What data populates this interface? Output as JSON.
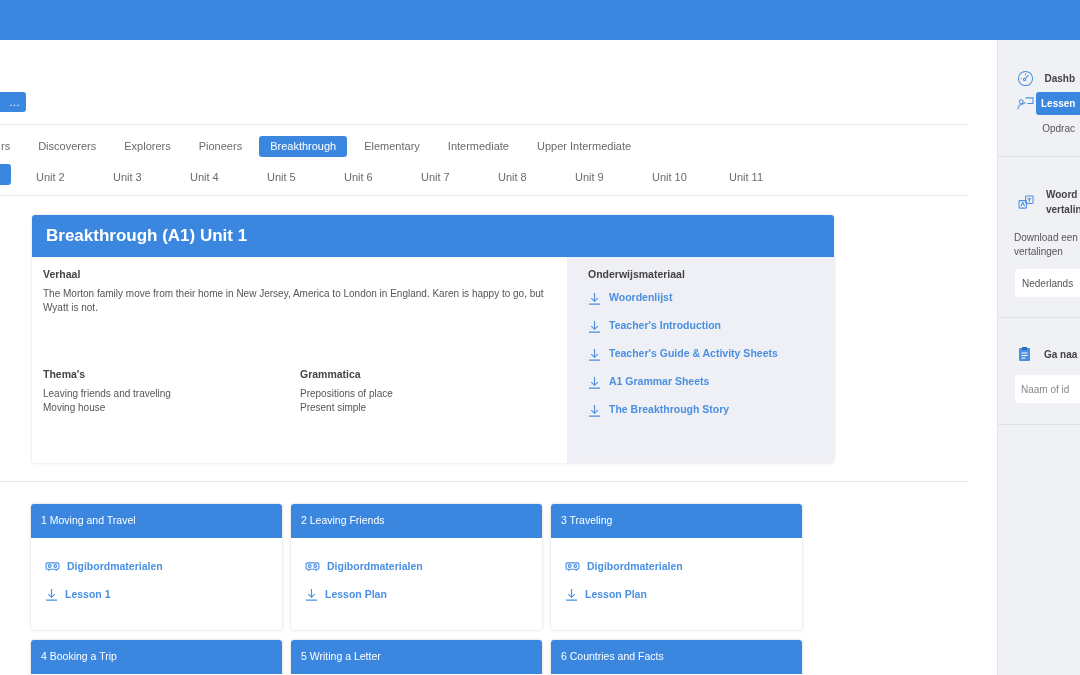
{
  "top_button": {
    "label": "…"
  },
  "levels": [
    {
      "label": "rs",
      "selected": false
    },
    {
      "label": "Discoverers",
      "selected": false
    },
    {
      "label": "Explorers",
      "selected": false
    },
    {
      "label": "Pioneers",
      "selected": false
    },
    {
      "label": "Breakthrough",
      "selected": true
    },
    {
      "label": "Elementary",
      "selected": false
    },
    {
      "label": "Intermediate",
      "selected": false
    },
    {
      "label": "Upper Intermediate",
      "selected": false
    }
  ],
  "units": [
    {
      "selected": true
    },
    {
      "label": "Unit 2",
      "selected": false
    },
    {
      "label": "Unit 3",
      "selected": false
    },
    {
      "label": "Unit 4",
      "selected": false
    },
    {
      "label": "Unit 5",
      "selected": false
    },
    {
      "label": "Unit 6",
      "selected": false
    },
    {
      "label": "Unit 7",
      "selected": false
    },
    {
      "label": "Unit 8",
      "selected": false
    },
    {
      "label": "Unit 9",
      "selected": false
    },
    {
      "label": "Unit 10",
      "selected": false
    },
    {
      "label": "Unit 11",
      "selected": false
    }
  ],
  "unit_card": {
    "title": "Breakthrough (A1) Unit 1",
    "story": {
      "heading": "Verhaal",
      "text": "The Morton family move from their home in New Jersey, America to London in England. Karen is happy to go, but Wyatt is not."
    },
    "themes": {
      "heading": "Thema's",
      "items": [
        "Leaving friends and traveling",
        "Moving house"
      ]
    },
    "grammar": {
      "heading": "Grammatica",
      "items": [
        "Prepositions of place",
        "Present simple"
      ]
    },
    "materials": {
      "heading": "Onderwijsmateriaal",
      "links": [
        "Woordenlijst",
        "Teacher's Introduction",
        "Teacher's Guide & Activity Sheets",
        "A1 Grammar Sheets",
        "The Breakthrough Story"
      ]
    }
  },
  "lessons": [
    {
      "title": "1 Moving and Travel",
      "links": [
        {
          "kind": "board",
          "label": "Digibordmaterialen"
        },
        {
          "kind": "download",
          "label": "Lesson 1"
        }
      ]
    },
    {
      "title": "2 Leaving Friends",
      "links": [
        {
          "kind": "board",
          "label": "Digibordmaterialen"
        },
        {
          "kind": "download",
          "label": "Lesson Plan"
        }
      ]
    },
    {
      "title": "3 Traveling",
      "links": [
        {
          "kind": "board",
          "label": "Digibordmaterialen"
        },
        {
          "kind": "download",
          "label": "Lesson Plan"
        }
      ]
    },
    {
      "title": "4 Booking a Trip"
    },
    {
      "title": "5 Writing a Letter"
    },
    {
      "title": "6 Countries and Facts"
    }
  ],
  "sidebar": {
    "nav": [
      {
        "kind": "dashboard",
        "label": "Dashb",
        "selected": false
      },
      {
        "kind": "lessons",
        "label": "Lessen",
        "selected": true
      },
      {
        "kind": "plain",
        "label": "Opdrac",
        "selected": false
      }
    ],
    "wordlists": {
      "heading": [
        "Woord",
        "vertalin"
      ],
      "text": [
        "Download een",
        "vertalingen"
      ],
      "select_value": "Nederlands"
    },
    "goto": {
      "heading": "Ga naa",
      "placeholder": "Naam of id"
    }
  }
}
